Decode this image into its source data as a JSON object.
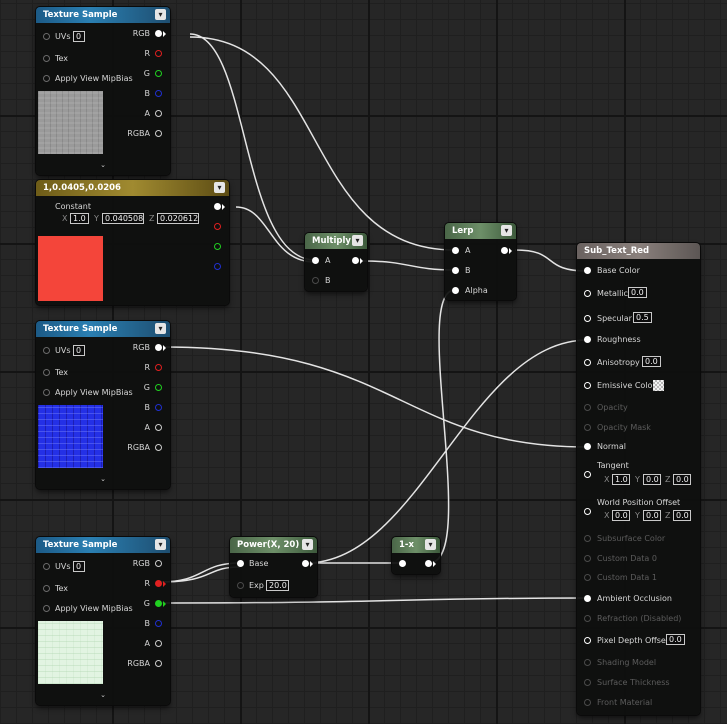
{
  "nodes": {
    "tex1": {
      "title": "Texture Sample",
      "inputs": {
        "uvs": "UVs",
        "uvs_value": "0",
        "tex": "Tex",
        "mip": "Apply View MipBias"
      },
      "outputs": {
        "rgb": "RGB",
        "r": "R",
        "g": "G",
        "b": "B",
        "a": "A",
        "rgba": "RGBA"
      },
      "thumb_color": "#9a9a9a"
    },
    "const": {
      "title": "1,0.0405,0.0206",
      "label": "Constant",
      "x_label": "X",
      "x_value": "1.0",
      "y_label": "Y",
      "y_value": "0.040508",
      "z_label": "Z",
      "z_value": "0.020612",
      "swatch_color": "#f4453a"
    },
    "tex2": {
      "title": "Texture Sample",
      "inputs": {
        "uvs": "UVs",
        "uvs_value": "0",
        "tex": "Tex",
        "mip": "Apply View MipBias"
      },
      "outputs": {
        "rgb": "RGB",
        "r": "R",
        "g": "G",
        "b": "B",
        "a": "A",
        "rgba": "RGBA"
      },
      "thumb_color": "#2430e6"
    },
    "tex3": {
      "title": "Texture Sample",
      "inputs": {
        "uvs": "UVs",
        "uvs_value": "0",
        "tex": "Tex",
        "mip": "Apply View MipBias"
      },
      "outputs": {
        "rgb": "RGB",
        "r": "R",
        "g": "G",
        "b": "B",
        "a": "A",
        "rgba": "RGBA"
      },
      "thumb_color": "#e2f4e2"
    },
    "multiply": {
      "title": "Multiply",
      "a": "A",
      "b": "B"
    },
    "lerp": {
      "title": "Lerp",
      "a": "A",
      "b": "B",
      "alpha": "Alpha"
    },
    "power": {
      "title": "Power(X, 20)",
      "base": "Base",
      "exp": "Exp",
      "exp_value": "20.0"
    },
    "oneminus": {
      "title": "1-x"
    },
    "material": {
      "title": "Sub_Text_Red",
      "base_color": "Base Color",
      "metallic": "Metallic",
      "metallic_value": "0.0",
      "specular": "Specular",
      "specular_value": "0.5",
      "roughness": "Roughness",
      "anisotropy": "Anisotropy",
      "anisotropy_value": "0.0",
      "emissive": "Emissive Color",
      "opacity": "Opacity",
      "opacity_mask": "Opacity Mask",
      "normal": "Normal",
      "tangent": "Tangent",
      "tangent_x_label": "X",
      "tangent_x": "1.0",
      "tangent_y_label": "Y",
      "tangent_y": "0.0",
      "tangent_z_label": "Z",
      "tangent_z": "0.0",
      "wpo": "World Position Offset",
      "wpo_x_label": "X",
      "wpo_x": "0.0",
      "wpo_y_label": "Y",
      "wpo_y": "0.0",
      "wpo_z_label": "Z",
      "wpo_z": "0.0",
      "subsurface": "Subsurface Color",
      "custom0": "Custom Data 0",
      "custom1": "Custom Data 1",
      "ao": "Ambient Occlusion",
      "refraction": "Refraction (Disabled)",
      "pdo": "Pixel Depth Offset",
      "pdo_value": "0.0",
      "shading_model": "Shading Model",
      "surface_thickness": "Surface Thickness",
      "front_material": "Front Material"
    }
  },
  "colors": {
    "pin_red": "#e02020",
    "pin_green": "#20d020",
    "pin_blue": "#2030d0",
    "wire": "#e8e8e8"
  }
}
